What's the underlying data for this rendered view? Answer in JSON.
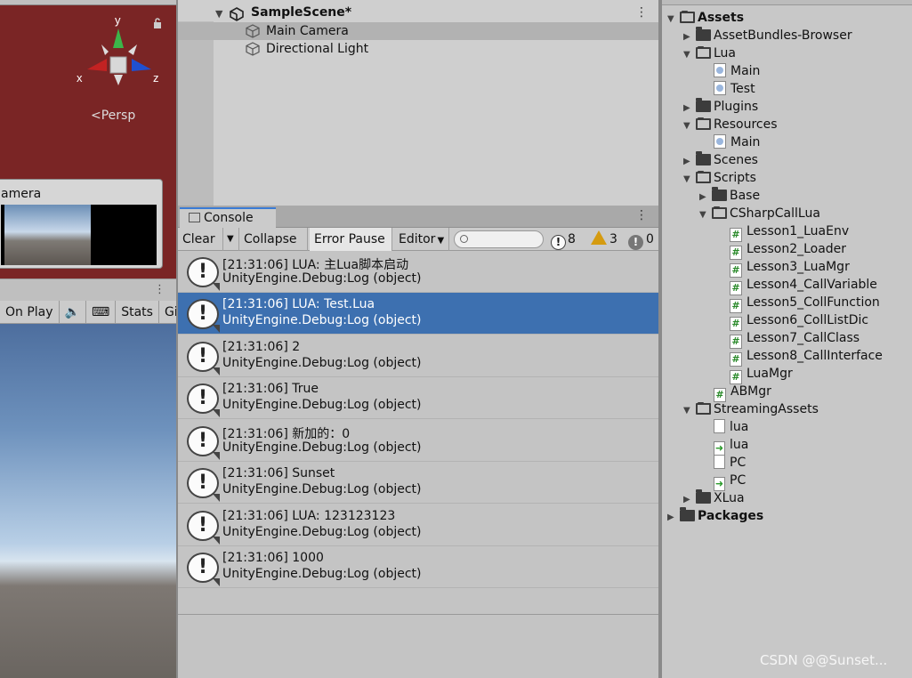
{
  "scene_view": {
    "axis_y": "y",
    "axis_x": "x",
    "axis_z": "z",
    "persp_label": "<Persp",
    "camera_preview_label": "amera"
  },
  "game_view": {
    "toolbar": [
      "On Play",
      "Stats",
      "Giz"
    ]
  },
  "hierarchy": {
    "scene_name": "SampleScene*",
    "objects": [
      "Main Camera",
      "Directional Light"
    ]
  },
  "console": {
    "tab_label": "Console",
    "toolbar": {
      "clear": "Clear",
      "collapse": "Collapse",
      "error_pause": "Error Pause",
      "editor": "Editor"
    },
    "search_placeholder": "",
    "counts": {
      "logs": "8",
      "warnings": "3",
      "errors": "0"
    },
    "entries": [
      {
        "line1": "[21:31:06] LUA: 主Lua脚本启动",
        "line2": "UnityEngine.Debug:Log (object)",
        "selected": false
      },
      {
        "line1": "[21:31:06] LUA: Test.Lua",
        "line2": "UnityEngine.Debug:Log (object)",
        "selected": true
      },
      {
        "line1": "[21:31:06] 2",
        "line2": "UnityEngine.Debug:Log (object)",
        "selected": false
      },
      {
        "line1": "[21:31:06] True",
        "line2": "UnityEngine.Debug:Log (object)",
        "selected": false
      },
      {
        "line1": "[21:31:06] 新加的：0",
        "line2": "UnityEngine.Debug:Log (object)",
        "selected": false
      },
      {
        "line1": "[21:31:06] Sunset",
        "line2": "UnityEngine.Debug:Log (object)",
        "selected": false
      },
      {
        "line1": "[21:31:06] LUA: 123123123",
        "line2": "UnityEngine.Debug:Log (object)",
        "selected": false
      },
      {
        "line1": "[21:31:06] 1000",
        "line2": "UnityEngine.Debug:Log (object)",
        "selected": false
      }
    ]
  },
  "project": {
    "tree": [
      {
        "label": "Assets",
        "type": "folder-open",
        "bold": true
      },
      {
        "label": "AssetBundles-Browser",
        "type": "folder"
      },
      {
        "label": "Lua",
        "type": "folder-open"
      },
      {
        "label": "Main",
        "type": "lua"
      },
      {
        "label": "Test",
        "type": "lua"
      },
      {
        "label": "Plugins",
        "type": "folder"
      },
      {
        "label": "Resources",
        "type": "folder-open"
      },
      {
        "label": "Main",
        "type": "lua"
      },
      {
        "label": "Scenes",
        "type": "folder"
      },
      {
        "label": "Scripts",
        "type": "folder-open"
      },
      {
        "label": "Base",
        "type": "folder"
      },
      {
        "label": "CSharpCallLua",
        "type": "folder-open"
      },
      {
        "label": "Lesson1_LuaEnv",
        "type": "script"
      },
      {
        "label": "Lesson2_Loader",
        "type": "script"
      },
      {
        "label": "Lesson3_LuaMgr",
        "type": "script"
      },
      {
        "label": "Lesson4_CallVariable",
        "type": "script"
      },
      {
        "label": "Lesson5_CollFunction",
        "type": "script"
      },
      {
        "label": "Lesson6_CollListDic",
        "type": "script"
      },
      {
        "label": "Lesson7_CallClass",
        "type": "script"
      },
      {
        "label": "Lesson8_CallInterface",
        "type": "script"
      },
      {
        "label": "LuaMgr",
        "type": "script"
      },
      {
        "label": "ABMgr",
        "type": "script"
      },
      {
        "label": "StreamingAssets",
        "type": "folder-open"
      },
      {
        "label": "lua",
        "type": "file"
      },
      {
        "label": "lua",
        "type": "bundle"
      },
      {
        "label": "PC",
        "type": "file"
      },
      {
        "label": "PC",
        "type": "bundle"
      },
      {
        "label": "XLua",
        "type": "folder"
      },
      {
        "label": "Packages",
        "type": "folder",
        "bold": true
      }
    ]
  },
  "watermark": "CSDN @@Sunset..."
}
